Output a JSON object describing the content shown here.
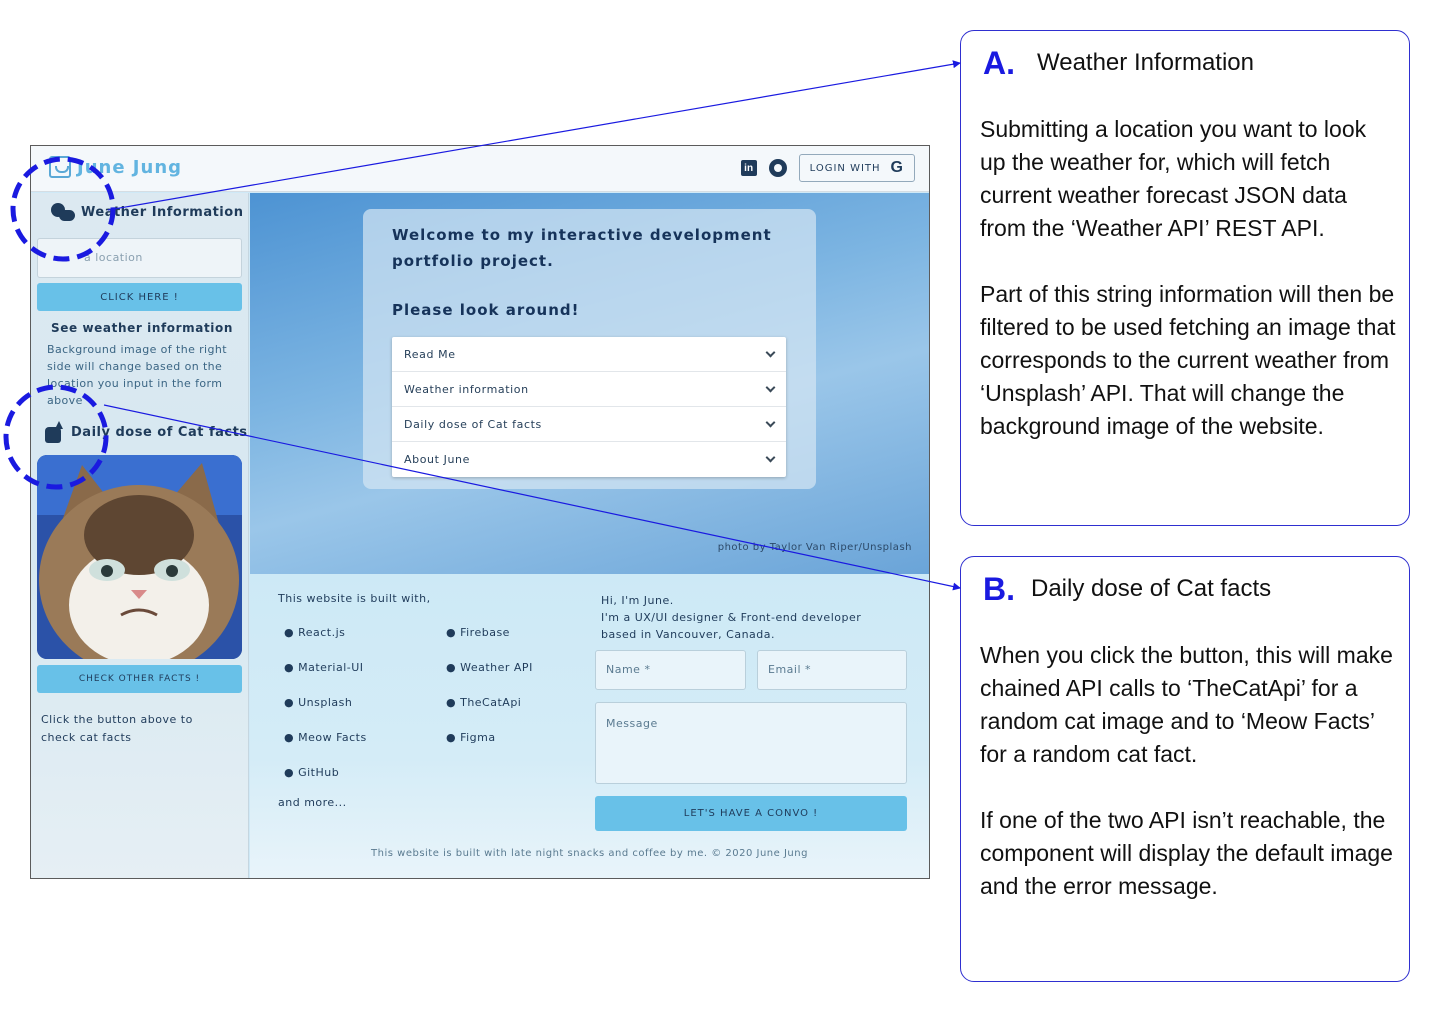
{
  "site": {
    "logo_text": "June Jung",
    "login_label": "LOGIN WITH",
    "login_icon": "G"
  },
  "sidebar": {
    "weather_heading": "Weather Information",
    "location_placeholder": "a location",
    "click_button": "CLICK HERE !",
    "see_weather_heading": "See weather information",
    "see_weather_desc": "Background image of the right side will change based on the location you input in the form above",
    "cat_heading": "Daily dose of Cat facts",
    "cat_button": "CHECK OTHER FACTS !",
    "cat_text": "Click the button above to check cat facts"
  },
  "hero": {
    "welcome": "Welcome to my interactive development portfolio project.",
    "look_around": "Please look around!",
    "accordion": [
      {
        "label": "Read Me"
      },
      {
        "label": "Weather information"
      },
      {
        "label": "Daily dose of Cat facts"
      },
      {
        "label": "About June"
      }
    ],
    "photo_credit": "photo by Taylor Van Riper/Unsplash"
  },
  "lower": {
    "built_with": "This website is built with,",
    "tech": [
      "● React.js",
      "● Firebase",
      "● Material-UI",
      "● Weather API",
      "● Unsplash",
      "● TheCatApi",
      "● Meow Facts",
      "● Figma",
      "● GitHub"
    ],
    "and_more": "and more...",
    "about_line1": "Hi, I'm June.",
    "about_line2": "I'm a UX/UI designer & Front-end developer",
    "about_line3": "based in Vancouver, Canada.",
    "name_label": "Name *",
    "email_label": "Email *",
    "message_label": "Message",
    "convo_button": "LET'S HAVE A CONVO !",
    "footer": "This website is built with late night snacks and coffee by me. © 2020 June Jung"
  },
  "annotations": {
    "a": {
      "letter": "A.",
      "title": "Weather Information",
      "para1": "Submitting a location you want to look up the weather for, which will fetch current weather forecast JSON data from the ‘Weather API’ REST API.",
      "para2": "Part of this string information will then be filtered to be used fetching an image that corresponds to the current weather from ‘Unsplash’ API. That will change the background image of the website."
    },
    "b": {
      "letter": "B.",
      "title": "Daily dose of Cat facts",
      "para1": "When you click the button, this will make chained API calls to ‘TheCatApi’ for a random cat image and to ‘Meow Facts’ for a random cat fact.",
      "para2": "If one of the two API isn’t reachable, the component will display the default image and the error message."
    }
  },
  "colors": {
    "accent": "#68c1e8",
    "navy": "#1f3b5a",
    "annotation_blue": "#1a1ae0"
  },
  "icons": [
    "logo-icon",
    "linkedin-icon",
    "github-icon",
    "google-icon",
    "weather-cloud-icon",
    "cat-icon",
    "chevron-down-icon"
  ]
}
